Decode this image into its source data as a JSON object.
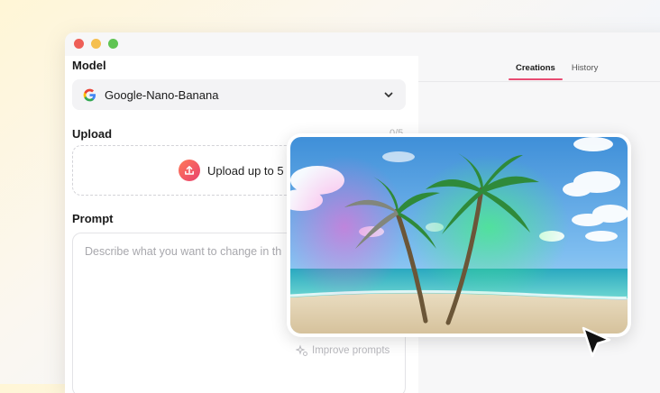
{
  "window": {
    "controls": [
      "close",
      "minimize",
      "maximize"
    ]
  },
  "left_panel": {
    "model": {
      "label": "Model",
      "selected": "Google-Nano-Banana",
      "icon": "google-g-icon"
    },
    "upload": {
      "label": "Upload",
      "count": "0/5",
      "button_text": "Upload up to 5 im",
      "icon": "upload-icon"
    },
    "prompt": {
      "label": "Prompt",
      "placeholder": "Describe what you want to change in th",
      "improve_label": "Improve prompts",
      "improve_icon": "sparkle-icon"
    }
  },
  "right_panel": {
    "tabs": [
      {
        "label": "Creations",
        "active": true
      },
      {
        "label": "History",
        "active": false
      }
    ],
    "preview": {
      "icon": "palm-beach-image"
    }
  },
  "colors": {
    "accent": "#e84b72",
    "upload_gradient_start": "#ff7a59",
    "upload_gradient_end": "#e8406d"
  },
  "cursor_icon": "mouse-pointer-icon"
}
